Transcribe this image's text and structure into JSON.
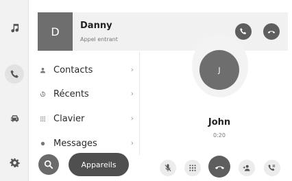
{
  "rail": {
    "items": [
      {
        "icon": "music-note-icon"
      },
      {
        "icon": "phone-icon",
        "active": true
      },
      {
        "icon": "car-icon"
      },
      {
        "icon": "settings-gear-icon"
      }
    ]
  },
  "incoming_call": {
    "avatar_initial": "D",
    "caller_name": "Danny",
    "status": "Appel entrant",
    "accept_icon": "phone-accept-icon",
    "decline_icon": "phone-decline-icon"
  },
  "menu": {
    "items": [
      {
        "label": "Contacts",
        "icon": "person-icon"
      },
      {
        "label": "Récents",
        "icon": "history-icon"
      },
      {
        "label": "Clavier",
        "icon": "keypad-icon"
      },
      {
        "label": "Messages",
        "icon": "message-dot-icon"
      }
    ],
    "chevron": "›"
  },
  "bottom_bar": {
    "search_icon": "search-icon",
    "devices_label": "Appareils"
  },
  "active_call": {
    "avatar_initial": "J",
    "contact_name": "John",
    "timer": "0:20",
    "controls": [
      {
        "name": "mute-mic-button",
        "icon": "mic-off-icon"
      },
      {
        "name": "keypad-button",
        "icon": "keypad-icon"
      },
      {
        "name": "end-call-button",
        "icon": "phone-hangup-icon"
      },
      {
        "name": "add-participant-button",
        "icon": "add-person-icon"
      },
      {
        "name": "transfer-call-button",
        "icon": "phone-transfer-icon"
      }
    ]
  },
  "colors": {
    "dark_button": "#5e5e5e",
    "avatar": "#6e6e6e",
    "banner_bg": "#f1f1f1",
    "rail_bg": "#f2f2f2"
  }
}
